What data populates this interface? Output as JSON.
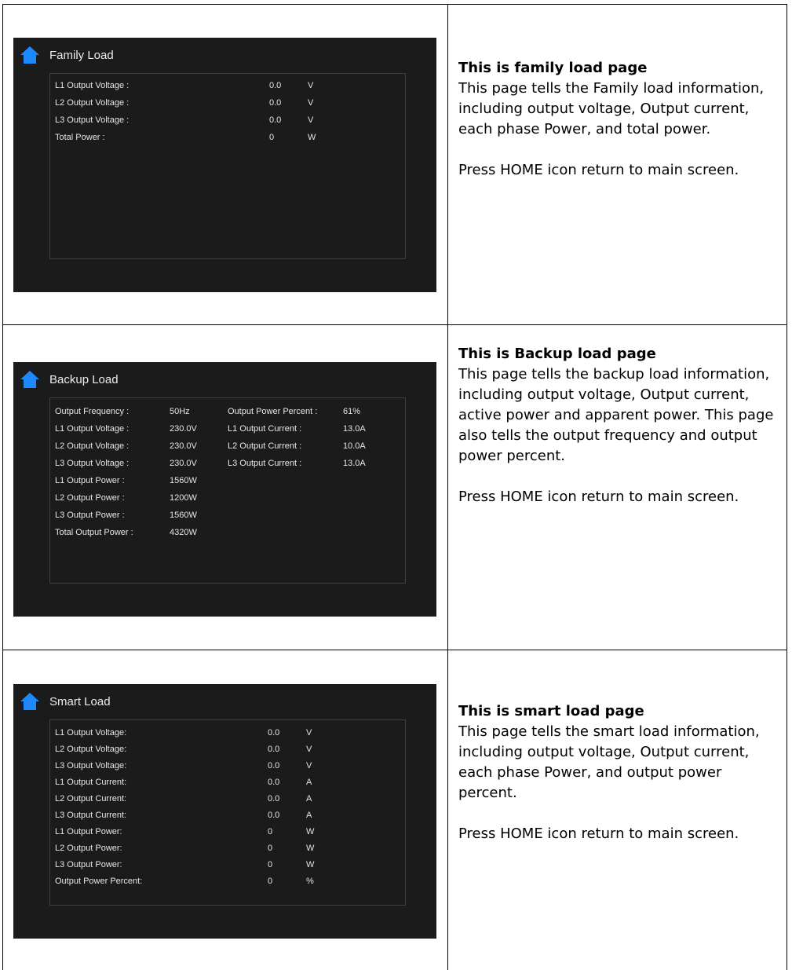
{
  "rows": [
    {
      "screen": {
        "title": "Family Load",
        "icon": "home-icon",
        "labels": [
          "L1 Output Voltage :",
          "L2 Output Voltage :",
          "L3 Output Voltage :",
          "Total Power :"
        ],
        "values": [
          "0.0",
          "0.0",
          "0.0",
          "0"
        ],
        "units": [
          "V",
          "V",
          "V",
          "W"
        ]
      },
      "description": {
        "title": "This is family load page",
        "body": "This page tells the Family load information, including output voltage, Output current, each phase Power, and total power.",
        "note": "Press HOME icon return to main screen."
      }
    },
    {
      "screen": {
        "title": "Backup Load",
        "icon": "home-icon",
        "left_labels": [
          "Output Frequency :",
          "L1 Output Voltage :",
          "L2 Output Voltage :",
          "L3 Output Voltage :",
          "L1 Output Power :",
          "L2 Output Power :",
          "L3 Output Power :",
          "Total Output Power :"
        ],
        "left_values": [
          "50Hz",
          "230.0V",
          "230.0V",
          "230.0V",
          "1560W",
          "1200W",
          "1560W",
          "4320W"
        ],
        "right_labels": [
          "Output Power Percent :",
          "L1 Output Current :",
          "L2 Output Current :",
          "L3 Output Current :"
        ],
        "right_values": [
          "61%",
          "13.0A",
          "10.0A",
          "13.0A"
        ]
      },
      "description": {
        "title": "This is Backup load page",
        "body": "This page tells the backup load information, including output voltage, Output current, active power and apparent power. This page also tells the output frequency and output power percent.",
        "note": "Press HOME icon return to main screen."
      }
    },
    {
      "screen": {
        "title": "Smart Load",
        "icon": "home-icon",
        "labels": [
          "L1 Output Voltage:",
          "L2 Output Voltage:",
          "L3 Output Voltage:",
          "L1 Output Current:",
          "L2 Output Current:",
          "L3 Output Current:",
          "L1 Output Power:",
          "L2 Output Power:",
          "L3 Output Power:",
          "Output Power Percent:"
        ],
        "values": [
          "0.0",
          "0.0",
          "0.0",
          "0.0",
          "0.0",
          "0.0",
          "0",
          "0",
          "0",
          "0"
        ],
        "units": [
          "V",
          "V",
          "V",
          "A",
          "A",
          "A",
          "W",
          "W",
          "W",
          "%"
        ]
      },
      "description": {
        "title": "This is smart load page",
        "body": "This page tells the smart load information, including output voltage, Output current, each phase Power, and output power percent.",
        "note": "Press HOME icon return to main screen."
      }
    }
  ],
  "colors": {
    "screen_bg": "#1b1b1b",
    "icon": "#1e88ff",
    "screen_text": "#e6e6e6",
    "panel_border": "#3f3f3f"
  }
}
